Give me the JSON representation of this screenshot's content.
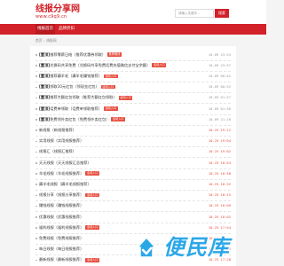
{
  "header": {
    "logo_main": "线报分享网",
    "logo_url": "www.c9q9.cn",
    "search_placeholder": "请输入关键字...",
    "search_button": "搜索"
  },
  "nav": {
    "items": [
      {
        "label": "线报首页",
        "active": true
      },
      {
        "label": "品牌折扣",
        "active": false
      }
    ]
  },
  "breadcrumb": {
    "home": "首页",
    "sep": "›",
    "current": "线报网"
  },
  "list": [
    {
      "tag": "[置顶]",
      "title": "推荐零薪日结（推荐优惠券领取）",
      "badge": "推荐赚钱",
      "date": "10-09 23:53",
      "hot": false
    },
    {
      "tag": "[置顶]",
      "title": "兑换码共享免费（兑换码共享免费话费充值微信支付宝余额）",
      "badge": "活动入口",
      "date": "10-09 23:57",
      "hot": false
    },
    {
      "tag": "[置顶]",
      "title": "推荐薅羊毛（薅羊毛赚钱推荐）",
      "badge": "活动入口",
      "date": "10-09 00:52",
      "hot": false
    },
    {
      "tag": "[置顶]",
      "title": "领取10元红包（领现金红包）",
      "badge": "活动入口",
      "date": "10-09 00:52",
      "hot": false
    },
    {
      "tag": "[置顶]",
      "title": "推荐大额红包领取（推荐大额红包领取）",
      "badge": "活动入口",
      "date": "10-09 01:57",
      "hot": false
    },
    {
      "tag": "[置顶]",
      "title": "话费单领取（话费单领取推荐）",
      "badge": "活动入口",
      "date": "10-09 01:56",
      "hot": false
    },
    {
      "tag": "[置顶]",
      "title": "免费领外卖红包（免费领外卖红包）",
      "badge": "活动入口",
      "date": "10-09 21:20",
      "hot": false
    },
    {
      "tag": "",
      "title": "新线报（新线报推荐）",
      "badge": "",
      "date": "10-25 19:12",
      "hot": true
    },
    {
      "tag": "",
      "title": "实用线报（实用线报推荐）",
      "badge": "",
      "date": "10-25 19:04",
      "hot": true
    },
    {
      "tag": "",
      "title": "线报汇（线报汇推荐）",
      "badge": "",
      "date": "10-25 19:02",
      "hot": true
    },
    {
      "tag": "",
      "title": "天天线报（天天线报汇总推荐）",
      "badge": "",
      "date": "10-25 18:54",
      "hot": true
    },
    {
      "tag": "",
      "title": "羊毛线报（羊毛线报推荐）",
      "badge": "活动入口",
      "date": "10-25 18:50",
      "hot": true
    },
    {
      "tag": "",
      "title": "薅羊毛线报（薅羊毛线报推荐）",
      "badge": "",
      "date": "10-25 18:32",
      "hot": true
    },
    {
      "tag": "",
      "title": "线报分享（线报分享推荐）",
      "badge": "活动入口",
      "date": "10-25 18:15",
      "hot": true
    },
    {
      "tag": "",
      "title": "赚钱线报（赚钱线报推荐）",
      "badge": "",
      "date": "10-25 18:09",
      "hot": true
    },
    {
      "tag": "",
      "title": "优惠线报（优惠线报推荐）",
      "badge": "",
      "date": "10-25 18:02",
      "hot": true
    },
    {
      "tag": "",
      "title": "福利线报（福利线报推荐）",
      "badge": "活动入口",
      "date": "10-25 17:54",
      "hot": true
    },
    {
      "tag": "",
      "title": "免费线报（免费线报推荐）",
      "badge": "",
      "date": "10-25 17:44",
      "hot": true
    },
    {
      "tag": "",
      "title": "每日线报（每日线报推荐）",
      "badge": "",
      "date": "10-25 17:36",
      "hot": true
    },
    {
      "tag": "",
      "title": "最新线报（最新线报推荐）",
      "badge": "活动入口",
      "date": "10-25 17:28",
      "hot": true
    }
  ],
  "watermark": {
    "text": "便民库",
    "icon": "bianminku-logo-icon"
  },
  "colors": {
    "brand": "#d22128",
    "badge": "#e74c3c",
    "watermark": "#2ba7e8"
  }
}
